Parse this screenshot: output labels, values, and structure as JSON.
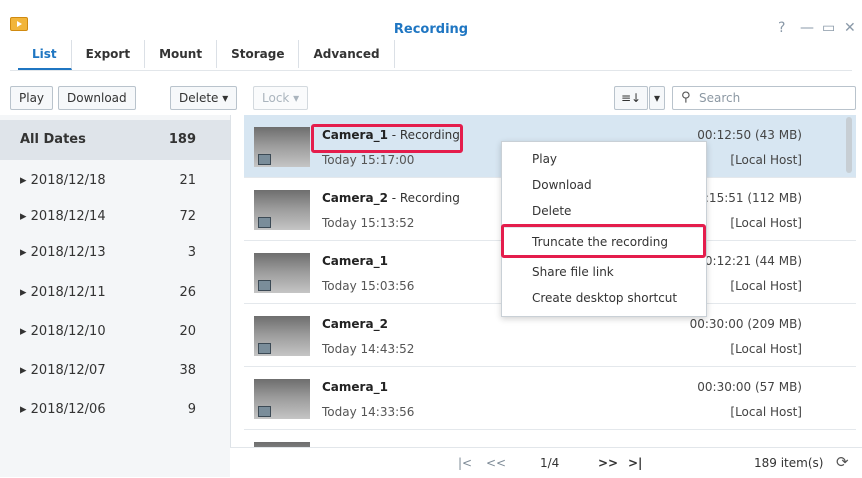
{
  "window": {
    "title": "Recording",
    "help": "?",
    "minimize": "—",
    "maximize": "▭",
    "close": "✕"
  },
  "tabs": [
    {
      "label": "List"
    },
    {
      "label": "Export"
    },
    {
      "label": "Mount"
    },
    {
      "label": "Storage"
    },
    {
      "label": "Advanced"
    }
  ],
  "toolbar": {
    "play": "Play",
    "download": "Download",
    "delete": "Delete ▾",
    "lock": "Lock ▾",
    "view_toggle": "≡↓",
    "view_arrow": "▾",
    "search_placeholder": "Search"
  },
  "sidebar": {
    "items": [
      {
        "label": "All Dates",
        "count": "189"
      },
      {
        "label": "▸ 2018/12/18",
        "count": "21"
      },
      {
        "label": "▸ 2018/12/14",
        "count": "72"
      },
      {
        "label": "▸ 2018/12/13",
        "count": "3"
      },
      {
        "label": "▸ 2018/12/11",
        "count": "26"
      },
      {
        "label": "▸ 2018/12/10",
        "count": "20"
      },
      {
        "label": "▸ 2018/12/07",
        "count": "38"
      },
      {
        "label": "▸ 2018/12/06",
        "count": "9"
      }
    ]
  },
  "recordings": [
    {
      "camera": "Camera_1",
      "status": " - Recording",
      "time": "Today 15:17:00",
      "duration": "00:12:50 (43 MB)",
      "host": "[Local Host]"
    },
    {
      "camera": "Camera_2",
      "status": " - Recording",
      "time": "Today 15:13:52",
      "duration": ":15:51 (112 MB)",
      "host": "[Local Host]"
    },
    {
      "camera": "Camera_1",
      "status": "",
      "time": "Today 15:03:56",
      "duration": "0:12:21 (44 MB)",
      "host": "[Local Host]"
    },
    {
      "camera": "Camera_2",
      "status": "",
      "time": "Today 14:43:52",
      "duration": "00:30:00 (209 MB)",
      "host": "[Local Host]"
    },
    {
      "camera": "Camera_1",
      "status": "",
      "time": "Today 14:33:56",
      "duration": "00:30:00 (57 MB)",
      "host": "[Local Host]"
    }
  ],
  "context_menu": {
    "items": [
      "Play",
      "Download",
      "Delete",
      "Truncate the recording",
      "Share file link",
      "Create desktop shortcut"
    ]
  },
  "pagination": {
    "first": "|<",
    "prev": "<<",
    "page": "1/4",
    "next": ">>",
    "last": ">|",
    "total": "189 item(s)",
    "refresh": "⟳"
  },
  "colors": {
    "accent": "#1f76c2",
    "highlight": "#e41d4c",
    "selected_row": "#d7e6f2"
  }
}
